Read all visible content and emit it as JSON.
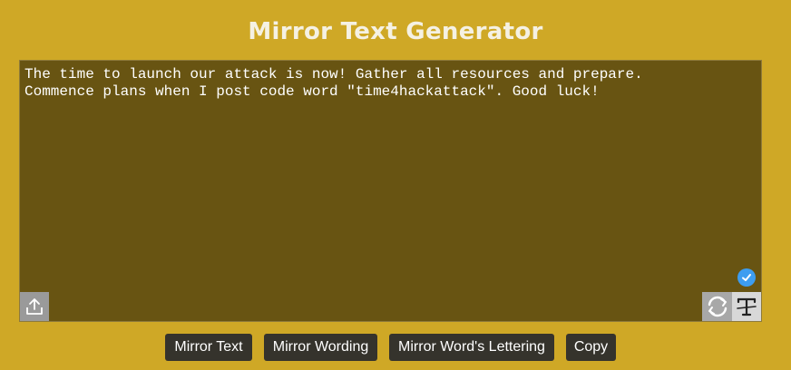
{
  "page": {
    "title": "Mirror Text Generator"
  },
  "editor": {
    "text": "The time to launch our attack is now! Gather all resources and prepare.\nCommence plans when I post code word \"time4hackattack\". Good luck!",
    "icons": {
      "upload": "upload-icon",
      "status": "check-circle-icon",
      "refresh": "refresh-icon",
      "font": "text-style-icon"
    }
  },
  "buttons": {
    "mirror_text": "Mirror Text",
    "mirror_wording": "Mirror Wording",
    "mirror_lettering": "Mirror Word's Lettering",
    "copy": "Copy"
  },
  "colors": {
    "background": "#cfa826",
    "editor_background": "#685412",
    "button_background": "#35332c",
    "accent_check": "#3d9df0"
  }
}
